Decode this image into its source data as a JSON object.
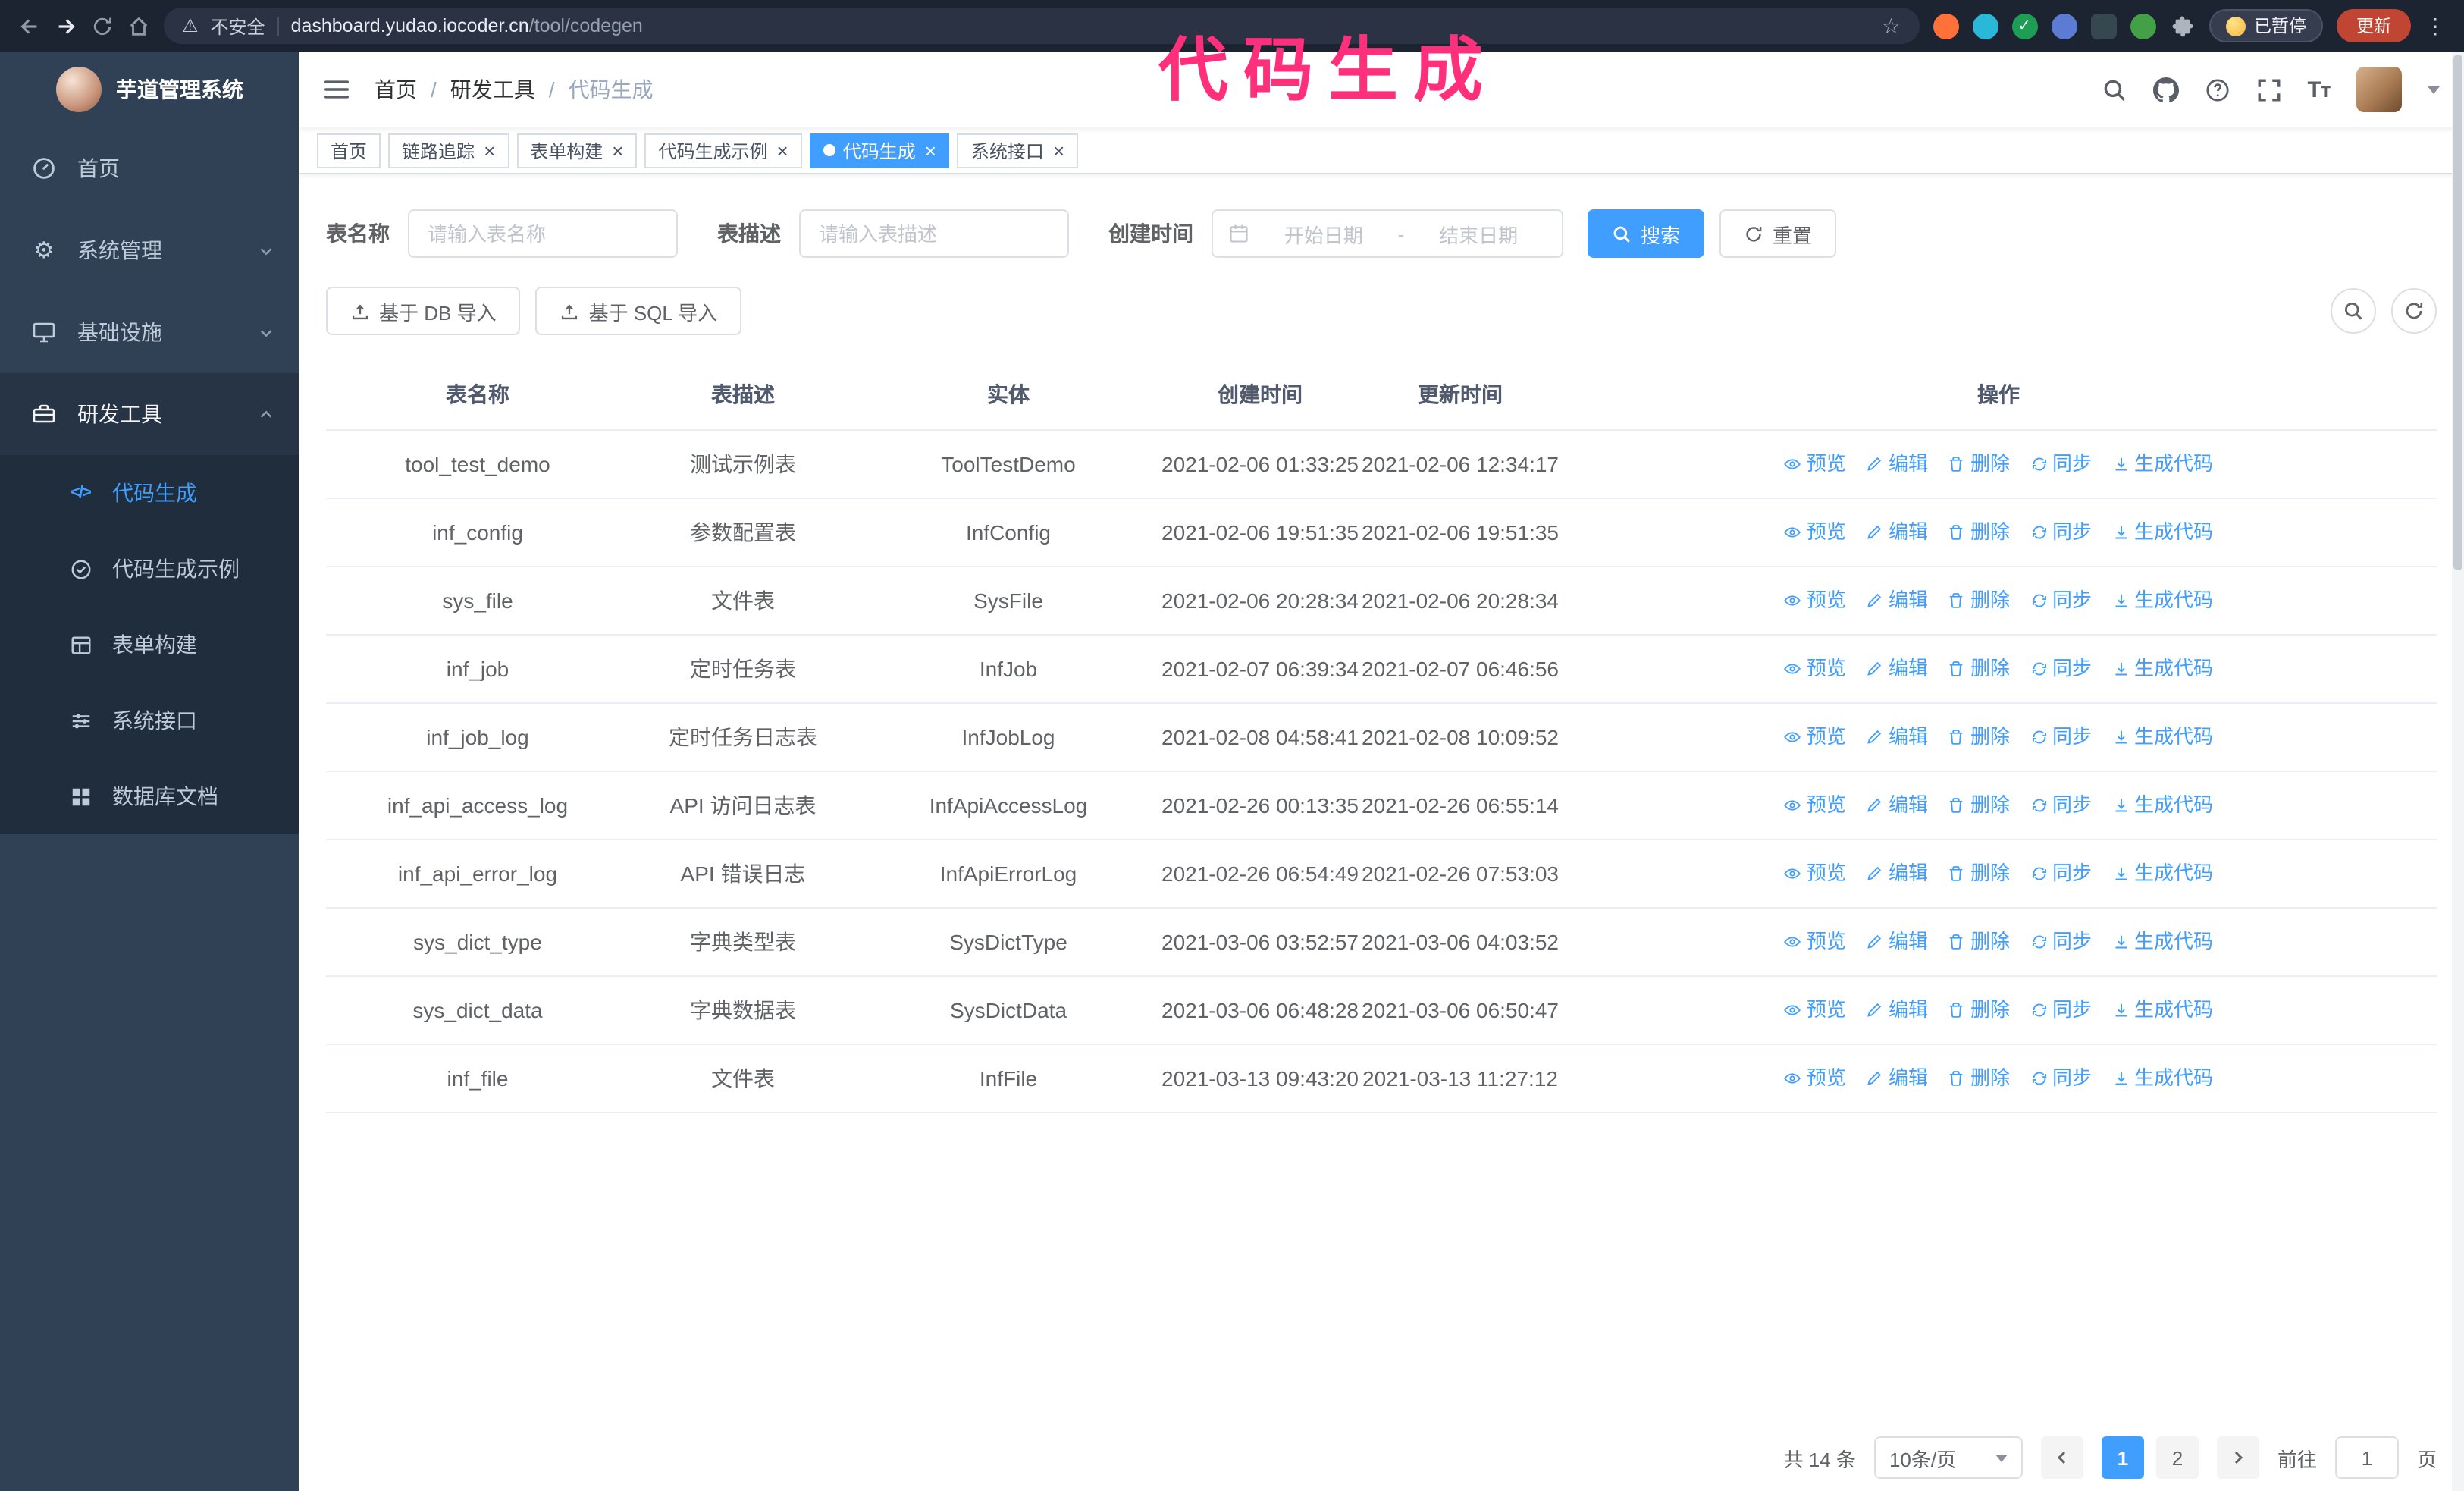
{
  "colors": {
    "accent": "#409EFF",
    "annotation": "#ff2f7b",
    "update": "#c04533",
    "sidebar_bg": "#304156",
    "submenu_bg": "#1f2d3d"
  },
  "annotation": {
    "text": "代码生成"
  },
  "browser": {
    "security_label": "不安全",
    "url_domain": "dashboard.yudao.iocoder.cn",
    "url_path": "/tool/codegen",
    "paused_badge": "已暂停",
    "update_button": "更新"
  },
  "sidebar": {
    "app_title": "芋道管理系统",
    "menu": [
      {
        "id": "home",
        "label": "首页",
        "icon": "dashboard"
      },
      {
        "id": "system",
        "label": "系统管理",
        "icon": "gear",
        "arrow": "down"
      },
      {
        "id": "infra",
        "label": "基础设施",
        "icon": "monitor",
        "arrow": "down"
      },
      {
        "id": "devtools",
        "label": "研发工具",
        "icon": "toolbox",
        "arrow": "up",
        "active": true,
        "children": [
          {
            "id": "codegen",
            "label": "代码生成",
            "icon": "code",
            "active": true
          },
          {
            "id": "codegen-example",
            "label": "代码生成示例",
            "icon": "badge"
          },
          {
            "id": "form-builder",
            "label": "表单构建",
            "icon": "form"
          },
          {
            "id": "api",
            "label": "系统接口",
            "icon": "sliders"
          },
          {
            "id": "db-doc",
            "label": "数据库文档",
            "icon": "db"
          }
        ]
      }
    ]
  },
  "header": {
    "breadcrumb": [
      "首页",
      "研发工具",
      "代码生成"
    ]
  },
  "tabs": [
    {
      "id": "home",
      "label": "首页",
      "closable": false
    },
    {
      "id": "tracer",
      "label": "链路追踪",
      "closable": true
    },
    {
      "id": "form-builder",
      "label": "表单构建",
      "closable": true
    },
    {
      "id": "codegen-example",
      "label": "代码生成示例",
      "closable": true
    },
    {
      "id": "codegen",
      "label": "代码生成",
      "closable": true,
      "active": true
    },
    {
      "id": "api",
      "label": "系统接口",
      "closable": true
    }
  ],
  "filters": {
    "table_name_label": "表名称",
    "table_name_placeholder": "请输入表名称",
    "table_desc_label": "表描述",
    "table_desc_placeholder": "请输入表描述",
    "create_time_label": "创建时间",
    "date_start_placeholder": "开始日期",
    "date_separator": "-",
    "date_end_placeholder": "结束日期",
    "search_button": "搜索",
    "reset_button": "重置"
  },
  "toolbar": {
    "import_db_button": "基于 DB 导入",
    "import_sql_button": "基于 SQL 导入"
  },
  "table": {
    "columns": [
      "表名称",
      "表描述",
      "实体",
      "创建时间",
      "更新时间",
      "操作"
    ],
    "actions": [
      {
        "id": "preview",
        "label": "预览",
        "icon": "eye-icon"
      },
      {
        "id": "edit",
        "label": "编辑",
        "icon": "edit-icon"
      },
      {
        "id": "delete",
        "label": "删除",
        "icon": "delete-icon"
      },
      {
        "id": "sync",
        "label": "同步",
        "icon": "sync-icon"
      },
      {
        "id": "generate",
        "label": "生成代码",
        "icon": "download-icon"
      }
    ],
    "rows": [
      {
        "name": "tool_test_demo",
        "desc": "测试示例表",
        "entity": "ToolTestDemo",
        "created": "2021-02-06 01:33:25",
        "updated": "2021-02-06 12:34:17"
      },
      {
        "name": "inf_config",
        "desc": "参数配置表",
        "entity": "InfConfig",
        "created": "2021-02-06 19:51:35",
        "updated": "2021-02-06 19:51:35"
      },
      {
        "name": "sys_file",
        "desc": "文件表",
        "entity": "SysFile",
        "created": "2021-02-06 20:28:34",
        "updated": "2021-02-06 20:28:34"
      },
      {
        "name": "inf_job",
        "desc": "定时任务表",
        "entity": "InfJob",
        "created": "2021-02-07 06:39:34",
        "updated": "2021-02-07 06:46:56"
      },
      {
        "name": "inf_job_log",
        "desc": "定时任务日志表",
        "entity": "InfJobLog",
        "created": "2021-02-08 04:58:41",
        "updated": "2021-02-08 10:09:52"
      },
      {
        "name": "inf_api_access_log",
        "desc": "API 访问日志表",
        "entity": "InfApiAccessLog",
        "created": "2021-02-26 00:13:35",
        "updated": "2021-02-26 06:55:14"
      },
      {
        "name": "inf_api_error_log",
        "desc": "API 错误日志",
        "entity": "InfApiErrorLog",
        "created": "2021-02-26 06:54:49",
        "updated": "2021-02-26 07:53:03"
      },
      {
        "name": "sys_dict_type",
        "desc": "字典类型表",
        "entity": "SysDictType",
        "created": "2021-03-06 03:52:57",
        "updated": "2021-03-06 04:03:52"
      },
      {
        "name": "sys_dict_data",
        "desc": "字典数据表",
        "entity": "SysDictData",
        "created": "2021-03-06 06:48:28",
        "updated": "2021-03-06 06:50:47"
      },
      {
        "name": "inf_file",
        "desc": "文件表",
        "entity": "InfFile",
        "created": "2021-03-13 09:43:20",
        "updated": "2021-03-13 11:27:12"
      }
    ]
  },
  "pagination": {
    "total": "共 14 条",
    "page_size": "10条/页",
    "pages": [
      "1",
      "2"
    ],
    "active_page": "1",
    "goto_label": "前往",
    "goto_value": "1",
    "goto_suffix": "页"
  }
}
